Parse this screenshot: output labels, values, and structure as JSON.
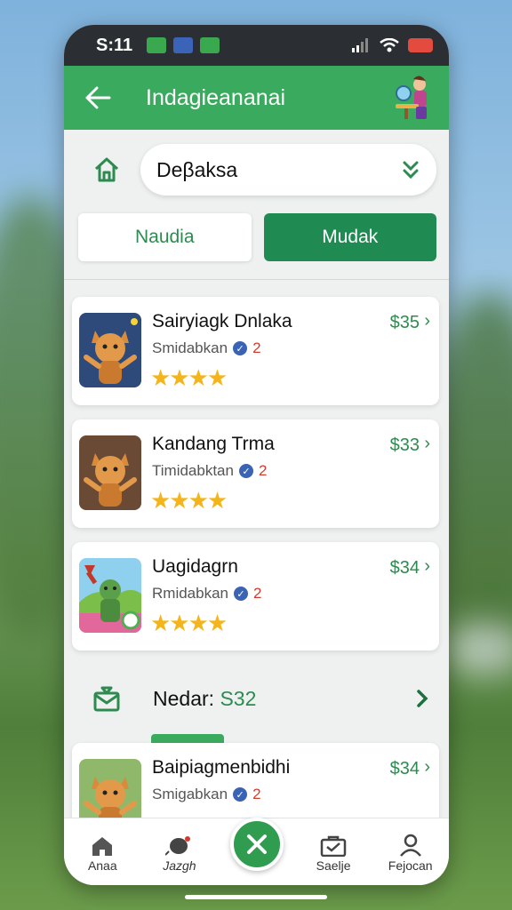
{
  "status_bar": {
    "time": "S:11",
    "notification_colors": [
      "#3aa84f",
      "#3b64b8",
      "#3aa84f"
    ]
  },
  "app_bar": {
    "back_icon": "arrow-left-icon",
    "title": "Indagieananai",
    "avatar_icon": "person-avatar-icon"
  },
  "selector": {
    "icon": "home-icon",
    "value": "Deβaksa",
    "chevron_icon": "chevron-down-icon"
  },
  "toggle": {
    "left_label": "Naudia",
    "right_label": "Mudak",
    "selected": "right"
  },
  "cards": [
    {
      "title": "Sairyiagk Dnlaka",
      "subtitle": "Smidabkan",
      "count": "2",
      "price": "$35",
      "stars": "★★★★",
      "thumb": "cat-character-icon"
    },
    {
      "title": "Kandang Trma",
      "subtitle": "Timidabktan",
      "count": "2",
      "price": "$33",
      "stars": "★★★★",
      "thumb": "cat-character-icon"
    },
    {
      "title": "Uagidagrn",
      "subtitle": "Rmidabkan",
      "count": "2",
      "price": "$34",
      "stars": "★★★★",
      "thumb": "frog-character-icon"
    },
    {
      "title": "Baipiagmenbidhi",
      "subtitle": "Smigabkan",
      "count": "2",
      "price": "$34",
      "stars": "",
      "thumb": "cat-character-icon"
    }
  ],
  "summary": {
    "icon": "inbox-icon",
    "label": "Nedar:",
    "value": "S32"
  },
  "bottom_nav": [
    {
      "label": "Anaa",
      "icon": "home-icon"
    },
    {
      "label": "Jazgh",
      "icon": "bird-icon"
    },
    {
      "label": "",
      "icon": "close-icon"
    },
    {
      "label": "Saelje",
      "icon": "briefcase-icon"
    },
    {
      "label": "Fejocan",
      "icon": "person-icon"
    }
  ],
  "colors": {
    "brand": "#3aaa5e",
    "brand_dark": "#1f8a51",
    "price": "#2e8b50",
    "star": "#f3b51b",
    "badge_count": "#d33b2e"
  }
}
